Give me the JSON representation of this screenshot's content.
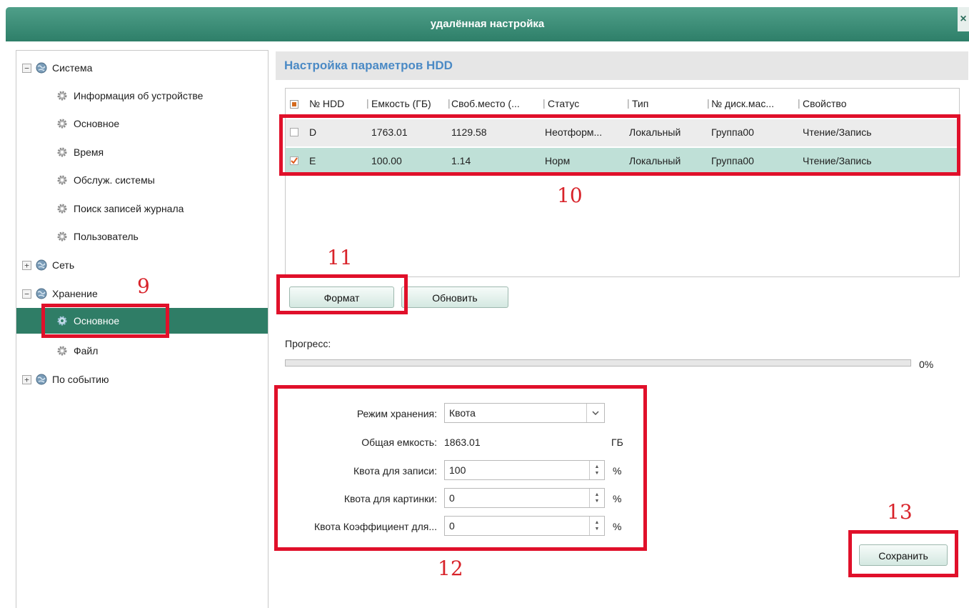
{
  "window": {
    "title": "удалённая настройка",
    "close_label": "×"
  },
  "sidebar": {
    "groups": [
      {
        "label": "Система",
        "expander": "−",
        "items": [
          "Информация об устройстве",
          "Основное",
          "Время",
          "Обслуж. системы",
          "Поиск записей журнала",
          "Пользователь"
        ]
      },
      {
        "label": "Сеть",
        "expander": "+"
      },
      {
        "label": "Хранение",
        "expander": "−",
        "items": [
          "Основное",
          "Файл"
        ]
      },
      {
        "label": "По событию",
        "expander": "+"
      }
    ],
    "selected": "Основное"
  },
  "section": {
    "title": "Настройка параметров HDD"
  },
  "hdd_table": {
    "columns": [
      "№ HDD",
      "Емкость (ГБ)",
      "Своб.место (...",
      "Статус",
      "Тип",
      "№ диск.мас...",
      "Свойство"
    ],
    "rows": [
      {
        "checked": false,
        "hdd": "D",
        "capacity": "1763.01",
        "free": "1129.58",
        "status": "Неотформ...",
        "type": "Локальный",
        "group": "Группа00",
        "property": "Чтение/Запись"
      },
      {
        "checked": true,
        "hdd": "E",
        "capacity": "100.00",
        "free": "1.14",
        "status": "Норм",
        "type": "Локальный",
        "group": "Группа00",
        "property": "Чтение/Запись"
      }
    ]
  },
  "buttons": {
    "format": "Формат",
    "refresh": "Обновить",
    "save": "Сохранить"
  },
  "progress": {
    "label": "Прогресс:",
    "value_text": "0%",
    "fraction": 0
  },
  "storage": {
    "mode_label": "Режим хранения:",
    "mode_value": "Квота",
    "total_label": "Общая емкость:",
    "total_value": "1863.01",
    "total_unit": "ГБ",
    "record_quota_label": "Квота для записи:",
    "record_quota_value": "100",
    "picture_quota_label": "Квота для картинки:",
    "picture_quota_value": "0",
    "coef_label": "Квота Коэффициент для...",
    "coef_value": "0",
    "percent": "%"
  },
  "annotations": {
    "n9": "9",
    "n10": "10",
    "n11": "11",
    "n12": "12",
    "n13": "13"
  },
  "colors": {
    "titlebar": "#3a8c75",
    "selected": "#2f7d66",
    "highlight_row": "#bfe0d7",
    "annotation": "#e0102a",
    "header_text": "#4b8ac5"
  }
}
